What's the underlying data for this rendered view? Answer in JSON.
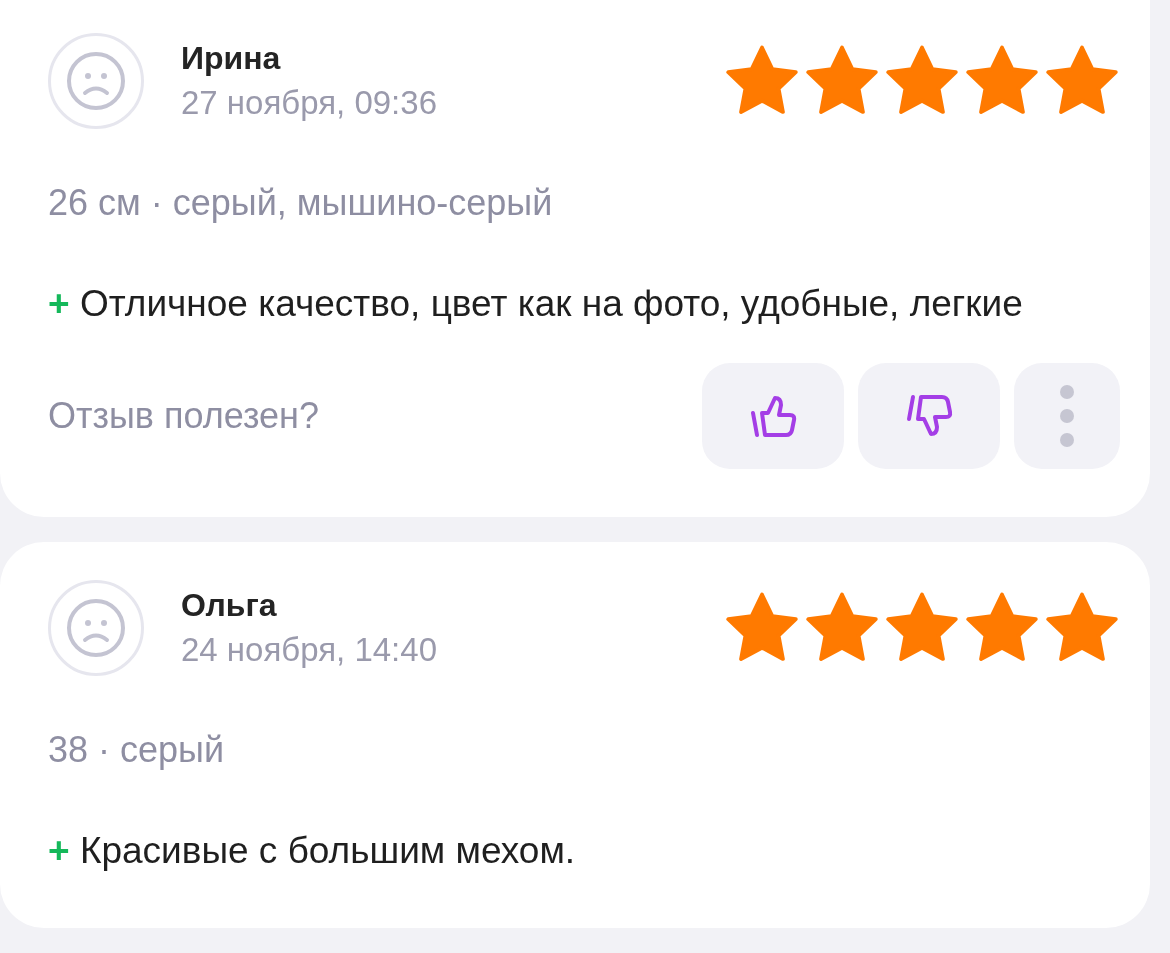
{
  "reviews": [
    {
      "name": "Ирина",
      "date": "27 ноября, 09:36",
      "stars": 5,
      "variant": "26 см · серый, мышино-серый",
      "pros": {
        "mark": "+",
        "text": "Отличное качество, цвет как на фото, удобные, легкие"
      },
      "helpful": {
        "prompt": "Отзыв полезен?"
      }
    },
    {
      "name": "Ольга",
      "date": "24 ноября, 14:40",
      "stars": 5,
      "variant": "38 · серый",
      "pros": {
        "mark": "+",
        "text": "Красивые с большим мехом."
      }
    }
  ]
}
